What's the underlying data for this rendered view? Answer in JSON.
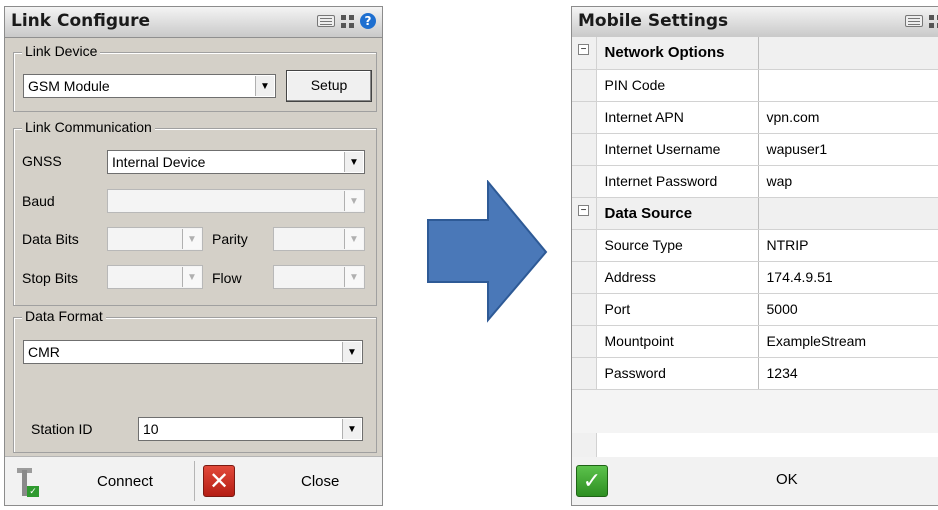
{
  "link_configure": {
    "title": "Link Configure",
    "link_device": {
      "legend": "Link Device",
      "device_value": "GSM Module",
      "setup_label": "Setup"
    },
    "link_communication": {
      "legend": "Link Communication",
      "gnss_label": "GNSS",
      "gnss_value": "Internal Device",
      "baud_label": "Baud",
      "data_bits_label": "Data Bits",
      "parity_label": "Parity",
      "stop_bits_label": "Stop Bits",
      "flow_label": "Flow"
    },
    "data_format": {
      "legend": "Data Format",
      "format_value": "CMR",
      "station_id_label": "Station ID",
      "station_id_value": "10"
    },
    "connect_label": "Connect",
    "close_label": "Close"
  },
  "mobile_settings": {
    "title": "Mobile Settings",
    "categories": [
      {
        "name": "Network Options",
        "rows": [
          {
            "name": "PIN Code",
            "value": ""
          },
          {
            "name": "Internet APN",
            "value": "vpn.com"
          },
          {
            "name": "Internet Username",
            "value": "wapuser1"
          },
          {
            "name": "Internet Password",
            "value": "wap"
          }
        ]
      },
      {
        "name": "Data Source",
        "rows": [
          {
            "name": "Source Type",
            "value": "NTRIP"
          },
          {
            "name": "Address",
            "value": "174.4.9.51"
          },
          {
            "name": "Port",
            "value": "5000"
          },
          {
            "name": "Mountpoint",
            "value": "ExampleStream"
          },
          {
            "name": "Password",
            "value": "1234"
          }
        ]
      }
    ],
    "ok_label": "OK"
  },
  "icons": {
    "keyboard": "keyboard-icon",
    "grid": "grid-icon",
    "help": "help-icon",
    "arrow": "right-arrow-icon",
    "antenna": "antenna-icon",
    "close": "close-x-icon",
    "ok": "checkmark-icon",
    "collapse": "collapse-icon"
  },
  "colors": {
    "arrow_fill": "#4a78b8",
    "arrow_stroke": "#2e5a96",
    "dialog_bg": "#d4d0c8"
  }
}
